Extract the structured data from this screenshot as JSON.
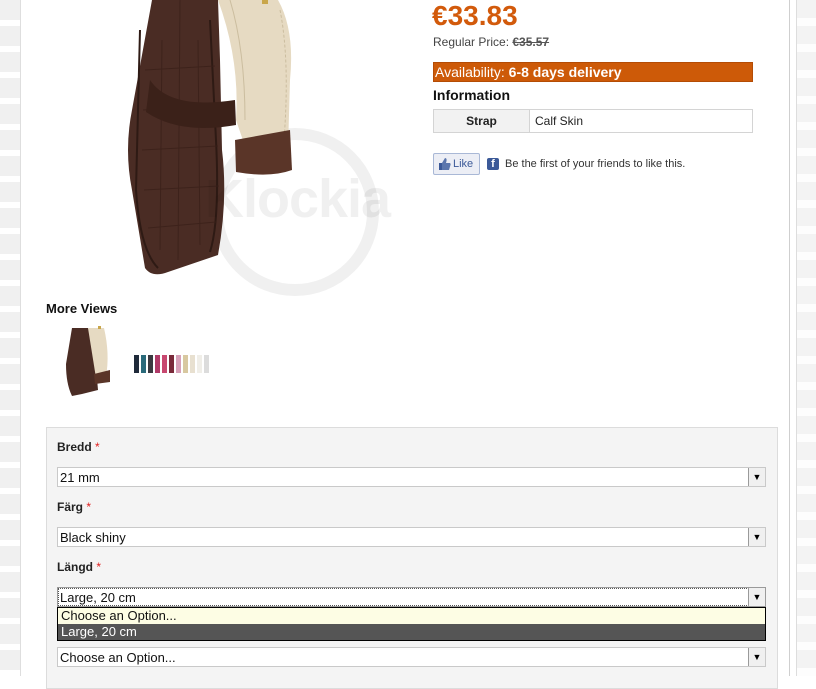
{
  "product": {
    "price": "€33.83",
    "regular_price_label": "Regular Price:",
    "regular_price_value": "€35.57",
    "availability_label": "Availability:",
    "availability_value": "6-8 days delivery",
    "info_title": "Information",
    "info_rows": [
      {
        "label": "Strap",
        "value": "Calf Skin"
      }
    ],
    "watermark": "Klockia"
  },
  "social": {
    "like_label": "Like",
    "friends_text": "Be the first of your friends to like this."
  },
  "more_views": {
    "title": "More Views"
  },
  "options": {
    "width_label": "Bredd",
    "width_value": "21 mm",
    "color_label": "Färg",
    "color_value": "Black shiny",
    "length_label": "Längd",
    "length_value": "Large, 20 cm",
    "length_options": [
      "Choose an Option...",
      "Large, 20 cm"
    ],
    "length_selected_index": 1,
    "next_value": "Choose an Option...",
    "required_mark": "*"
  },
  "colors": {
    "accent": "#d25a0b",
    "availability_bg": "#cd5a08",
    "strap_brown": "#4a2c24"
  },
  "icons": {
    "like": "thumbs-up-icon",
    "facebook": "facebook-icon",
    "dropdown": "chevron-down-icon"
  }
}
